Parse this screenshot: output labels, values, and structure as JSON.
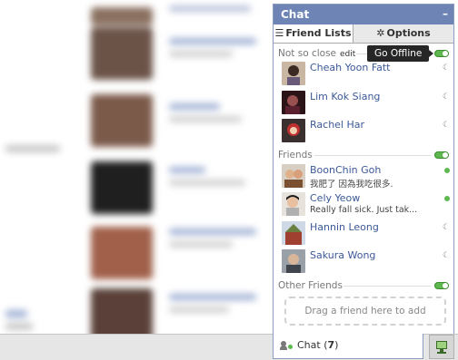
{
  "chat": {
    "title": "Chat",
    "minimize": "–",
    "tabs": {
      "friend_lists": "Friend Lists",
      "options": "Options"
    },
    "tooltip": "Go Offline",
    "groups": {
      "not_so_close": {
        "label": "Not so close",
        "edit": "edit"
      },
      "friends": {
        "label": "Friends"
      },
      "other_friends": {
        "label": "Other Friends"
      }
    },
    "friends_not_so_close": [
      {
        "name": "Cheah Yoon Fatt",
        "status": "idle"
      },
      {
        "name": "Lim Kok Siang",
        "status": "idle"
      },
      {
        "name": "Rachel Har",
        "status": "idle"
      }
    ],
    "friends_main": [
      {
        "name": "BoonChin Goh",
        "message": "我肥了 因為我吃很多.",
        "status": "online"
      },
      {
        "name": "Cely Yeow",
        "message": "Really fall sick. Just tak...",
        "status": "online"
      },
      {
        "name": "Hannin Leong",
        "message": "",
        "status": "idle"
      },
      {
        "name": "Sakura Wong",
        "message": "",
        "status": "idle"
      }
    ],
    "drop_zone": "Drag a friend here to add",
    "footer": {
      "label": "Chat",
      "open": "(",
      "count": "7",
      "close": ")"
    }
  },
  "colors": {
    "header": "#6d84b4",
    "online": "#5eb84f",
    "link": "#3b5998"
  }
}
